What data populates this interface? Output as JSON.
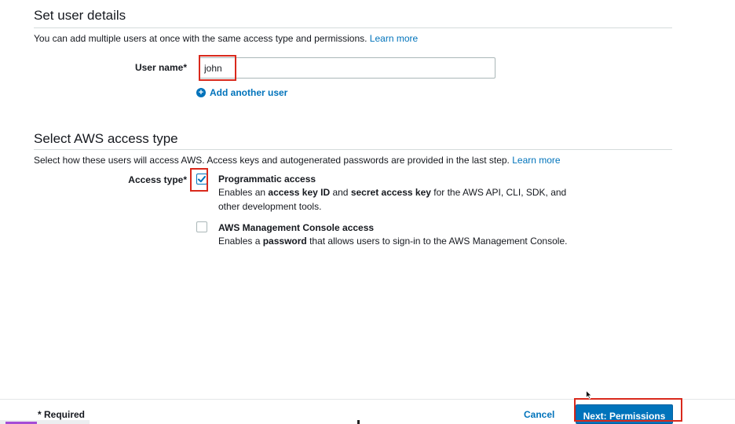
{
  "user_details": {
    "title": "Set user details",
    "description": "You can add multiple users at once with the same access type and permissions.",
    "learn_more": "Learn more",
    "username_label": "User name*",
    "username_value": "john",
    "add_another_user": "Add another user"
  },
  "access_type": {
    "title": "Select AWS access type",
    "description": "Select how these users will access AWS. Access keys and autogenerated passwords are provided in the last step.",
    "learn_more": "Learn more",
    "label": "Access type*",
    "options": [
      {
        "title": "Programmatic access",
        "checked": true,
        "desc": {
          "p1": "Enables an ",
          "b1": "access key ID",
          "p2": " and ",
          "b2": "secret access key",
          "p3": " for the AWS API, CLI, SDK, and",
          "line2": "other development tools."
        }
      },
      {
        "title": "AWS Management Console access",
        "checked": false,
        "desc": {
          "p1": "Enables a ",
          "b1": "password",
          "p2": " that allows users to sign-in to the AWS Management Console."
        }
      }
    ]
  },
  "footer": {
    "required_note": "* Required",
    "cancel_label": "Cancel",
    "next_label": "Next: Permissions"
  },
  "colors": {
    "link": "#0073bb",
    "primary_button": "#0073bb",
    "highlight": "#d9291c",
    "divider": "#d5dbdb"
  },
  "icons": {
    "add_user": "plus-circle-icon",
    "checkmark": "checkmark-icon",
    "cursor": "mouse-pointer-icon"
  }
}
